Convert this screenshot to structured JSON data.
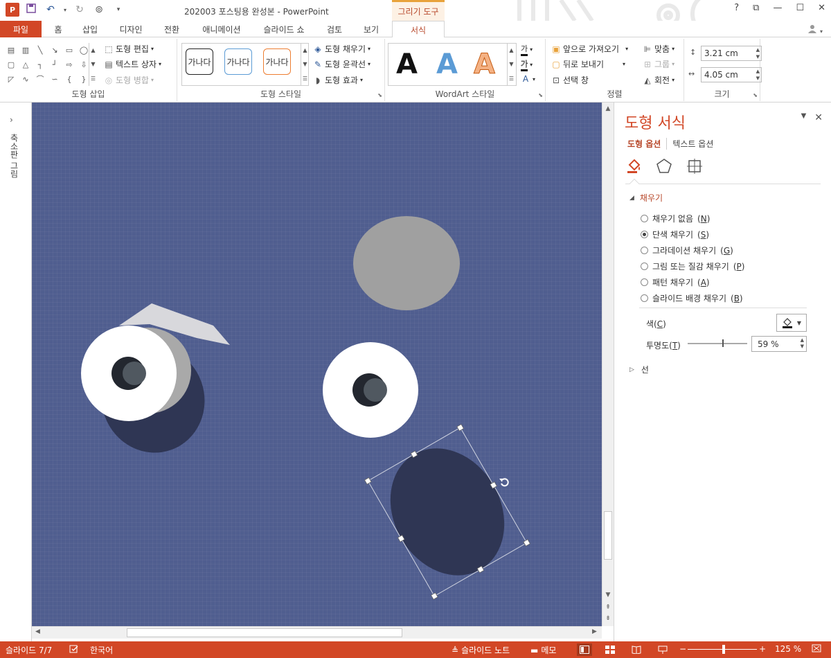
{
  "window": {
    "title": "202003 포스팅용 완성본 - PowerPoint",
    "contextual_tab_group": "그리기 도구",
    "app_icon_label": "P",
    "controls": [
      "?",
      "⧉",
      "—",
      "☐",
      "✕"
    ]
  },
  "tabs": {
    "file": "파일",
    "home": "홈",
    "insert": "삽입",
    "design": "디자인",
    "transitions": "전환",
    "animations": "애니메이션",
    "slideshow": "슬라이드 쇼",
    "review": "검토",
    "view": "보기",
    "format": "서식"
  },
  "ribbon": {
    "insert_shapes": {
      "label": "도형 삽입",
      "edit_shape": "도형 편집",
      "text_box": "텍스트 상자",
      "merge_shapes": "도형 병합"
    },
    "shape_styles": {
      "label": "도형 스타일",
      "style_sample_1": "가나다",
      "style_sample_2": "가나다",
      "style_sample_3": "가나다",
      "fill": "도형 채우기",
      "outline": "도형 윤곽선",
      "effects": "도형 효과"
    },
    "wordart": {
      "label": "WordArt 스타일",
      "sample_letter": "A",
      "text_fill_glyph": "가",
      "text_outline_glyph": "가"
    },
    "arrange": {
      "label": "정렬",
      "bring_forward": "앞으로 가져오기",
      "send_backward": "뒤로 보내기",
      "selection_pane": "선택 창",
      "align": "맞춤",
      "group": "그룹",
      "rotate": "회전"
    },
    "size": {
      "label": "크기",
      "height": "3.21 cm",
      "width": "4.05 cm"
    }
  },
  "thumbnail_pane": {
    "label": "축소판 그림"
  },
  "format_pane": {
    "title": "도형 서식",
    "tab_shape_options": "도형 옵션",
    "tab_text_options": "텍스트 옵션",
    "fill_section": "채우기",
    "options": [
      {
        "label": "채우기 없음",
        "key": "N",
        "selected": false
      },
      {
        "label": "단색 채우기",
        "key": "S",
        "selected": true
      },
      {
        "label": "그라데이션 채우기",
        "key": "G",
        "selected": false
      },
      {
        "label": "그림 또는 질감 채우기",
        "key": "P",
        "selected": false
      },
      {
        "label": "패턴 채우기",
        "key": "A",
        "selected": false
      },
      {
        "label": "슬라이드 배경 채우기",
        "key": "B",
        "selected": false
      }
    ],
    "color_label": "색",
    "color_key": "C",
    "transparency_label": "투명도",
    "transparency_key": "T",
    "transparency_value": "59 %",
    "transparency_fraction": 0.59,
    "line_section": "선"
  },
  "status": {
    "slide": "슬라이드 7/7",
    "language": "한국어",
    "notes": "슬라이드 노트",
    "comments": "메모",
    "zoom": "125 %"
  },
  "colors": {
    "accent": "#d24726",
    "slide_bg": "#505e8f",
    "shadow": "#2f3654",
    "eye_white": "#ffffff",
    "gray_shape": "#a0a0a0"
  }
}
